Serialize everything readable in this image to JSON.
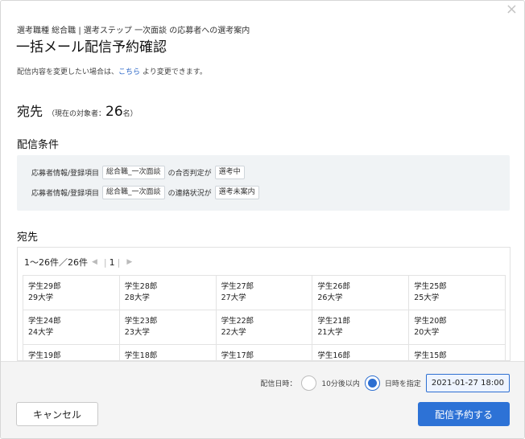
{
  "header": {
    "close_icon": "×",
    "subtitle": "選考職種 総合職 | 選考ステップ 一次面談 の応募者への選考案内",
    "title": "一括メール配信予約確認"
  },
  "note": {
    "prefix": "配信内容を変更したい場合は、",
    "link": "こちら",
    "suffix": " より変更できます。"
  },
  "destination": {
    "heading": "宛先",
    "count_label": "（現在の対象者：",
    "count": "26",
    "count_unit": "名）"
  },
  "conditions": {
    "heading": "配信条件",
    "rows": [
      {
        "field": "応募者情報/登録項目",
        "item": "総合職_一次面談",
        "relation": "の合否判定が",
        "value": "選考中"
      },
      {
        "field": "応募者情報/登録項目",
        "item": "総合職_一次面談",
        "relation": "の連絡状況が",
        "value": "選考未案内"
      }
    ]
  },
  "recipients": {
    "heading": "宛先",
    "pager": {
      "range": "1〜26件／26件",
      "prev_icon": "◀",
      "page": "1",
      "next_icon": "▶"
    },
    "rows": [
      [
        {
          "name": "学生29郎",
          "school": "29大学"
        },
        {
          "name": "学生28郎",
          "school": "28大学"
        },
        {
          "name": "学生27郎",
          "school": "27大学"
        },
        {
          "name": "学生26郎",
          "school": "26大学"
        },
        {
          "name": "学生25郎",
          "school": "25大学"
        }
      ],
      [
        {
          "name": "学生24郎",
          "school": "24大学"
        },
        {
          "name": "学生23郎",
          "school": "23大学"
        },
        {
          "name": "学生22郎",
          "school": "22大学"
        },
        {
          "name": "学生21郎",
          "school": "21大学"
        },
        {
          "name": "学生20郎",
          "school": "20大学"
        }
      ],
      [
        {
          "name": "学生19郎",
          "school": ""
        },
        {
          "name": "学生18郎",
          "school": ""
        },
        {
          "name": "学生17郎",
          "school": ""
        },
        {
          "name": "学生16郎",
          "school": ""
        },
        {
          "name": "学生15郎",
          "school": ""
        }
      ]
    ]
  },
  "footer": {
    "schedule_label": "配信日時：",
    "option_soon": "10分後以内",
    "option_specified": "日時を指定",
    "datetime_value": "2021-01-27 18:00",
    "cancel_label": "キャンセル",
    "submit_label": "配信予約する"
  },
  "colors": {
    "accent": "#2d72d6",
    "link": "#2a66c7"
  }
}
